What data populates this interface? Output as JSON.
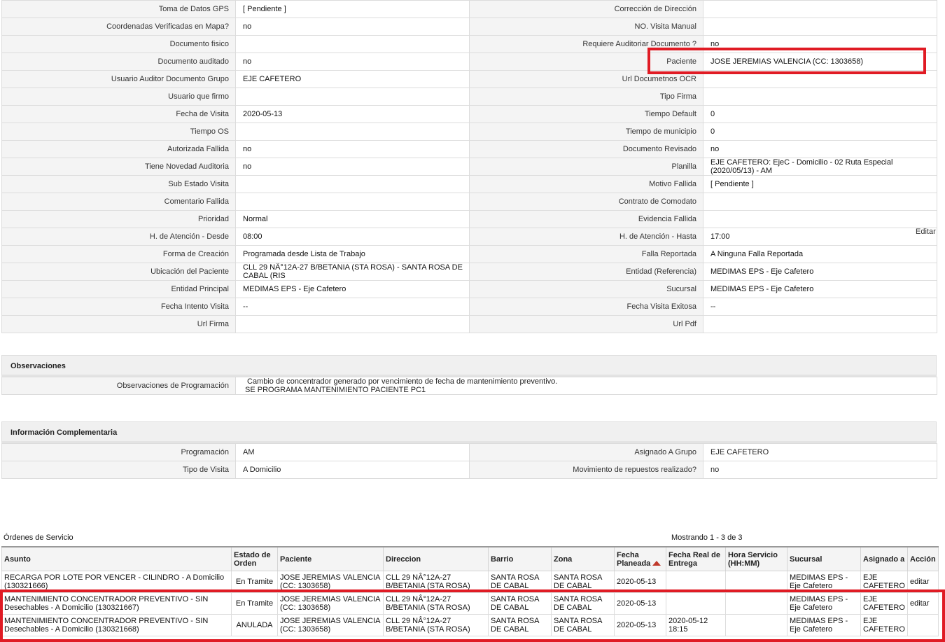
{
  "details": [
    [
      "Toma de Datos GPS",
      "[ Pendiente ]",
      "Corrección de Dirección",
      ""
    ],
    [
      "Coordenadas Verificadas en Mapa?",
      "no",
      "NO. Visita Manual",
      ""
    ],
    [
      "Documento fisico",
      "",
      "Requiere Auditoriar Documento ?",
      "no"
    ],
    [
      "Documento auditado",
      "no",
      "Paciente",
      "JOSE JEREMIAS VALENCIA (CC: 1303658)"
    ],
    [
      "Usuario Auditor Documento Grupo",
      "EJE CAFETERO",
      "Url Documetnos OCR",
      ""
    ],
    [
      "Usuario que firmo",
      "",
      "Tipo Firma",
      ""
    ],
    [
      "Fecha de Visita",
      "2020-05-13",
      "Tiempo Default",
      "0"
    ],
    [
      "Tiempo OS",
      "",
      "Tiempo de municipio",
      "0"
    ],
    [
      "Autorizada Fallida",
      "no",
      "Documento Revisado",
      "no"
    ],
    [
      "Tiene Novedad Auditoria",
      "no",
      "Planilla",
      "EJE CAFETERO: EjeC - Domicilio - 02 Ruta Especial (2020/05/13) - AM"
    ],
    [
      "Sub Estado Visita",
      "",
      "Motivo Fallida",
      "[ Pendiente ]"
    ],
    [
      "Comentario Fallida",
      "",
      "Contrato de Comodato",
      ""
    ],
    [
      "Prioridad",
      "Normal",
      "Evidencia Fallida",
      ""
    ],
    [
      "H. de Atención - Desde",
      "08:00",
      "H. de Atención - Hasta",
      "17:00"
    ],
    [
      "Forma de Creación",
      "Programada desde Lista de Trabajo",
      "Falla Reportada",
      "A Ninguna Falla Reportada"
    ],
    [
      "Ubicación del Paciente",
      "CLL 29 NÂ°12A-27 B/BETANIA (STA ROSA) - SANTA ROSA DE CABAL (RIS",
      "Entidad (Referencia)",
      "MEDIMAS EPS - Eje Cafetero"
    ],
    [
      "Entidad Principal",
      "MEDIMAS EPS - Eje Cafetero",
      "Sucursal",
      "MEDIMAS EPS - Eje Cafetero"
    ],
    [
      "Fecha Intento Visita",
      "--",
      "Fecha Visita Exitosa",
      "--"
    ],
    [
      "Url Firma",
      "",
      "Url Pdf",
      ""
    ]
  ],
  "editar_label": "Editar",
  "observaciones": {
    "title": "Observaciones",
    "label": "Observaciones de Programación",
    "line1": "Cambio de concentrador generado por vencimiento de fecha de mantenimiento preventivo.",
    "line2": "SE PROGRAMA MANTENIMIENTO PACIENTE PC1"
  },
  "complementaria": {
    "title": "Información Complementaria",
    "rows": [
      [
        "Programación",
        "AM",
        "Asignado A Grupo",
        "EJE CAFETERO"
      ],
      [
        "Tipo de Visita",
        "A Domicilio",
        "Movimiento de repuestos realizado?",
        "no"
      ]
    ]
  },
  "orders": {
    "title": "Órdenes de Servicio",
    "showing": "Mostrando 1 - 3 de 3",
    "headers": [
      "Asunto",
      "Estado de Orden",
      "Paciente",
      "Direccion",
      "Barrio",
      "Zona",
      "Fecha Planeada",
      "Fecha Real de Entrega",
      "Hora Servicio (HH:MM)",
      "Sucursal",
      "Asignado a",
      "Acción"
    ],
    "rows": [
      [
        "RECARGA POR LOTE POR VENCER - CILINDRO - A Domicilio (130321666)",
        "En Tramite",
        "JOSE JEREMIAS VALENCIA (CC: 1303658)",
        "CLL 29 NÂ°12A-27 B/BETANIA (STA ROSA)",
        "SANTA ROSA DE CABAL",
        "SANTA ROSA DE CABAL",
        "2020-05-13",
        "",
        "",
        "MEDIMAS EPS - Eje Cafetero",
        "EJE CAFETERO",
        "editar"
      ],
      [
        "MANTENIMIENTO CONCENTRADOR PREVENTIVO - SIN Desechables - A Domicilio (130321667)",
        "En Tramite",
        "JOSE JEREMIAS VALENCIA (CC: 1303658)",
        "CLL 29 NÂ°12A-27 B/BETANIA (STA ROSA)",
        "SANTA ROSA DE CABAL",
        "SANTA ROSA DE CABAL",
        "2020-05-13",
        "",
        "",
        "MEDIMAS EPS - Eje Cafetero",
        "EJE CAFETERO",
        "editar"
      ],
      [
        "MANTENIMIENTO CONCENTRADOR PREVENTIVO - SIN Desechables - A Domicilio (130321668)",
        "ANULADA",
        "JOSE JEREMIAS VALENCIA (CC: 1303658)",
        "CLL 29 NÂ°12A-27 B/BETANIA (STA ROSA)",
        "SANTA ROSA DE CABAL",
        "SANTA ROSA DE CABAL",
        "2020-05-13",
        "2020-05-12 18:15",
        "",
        "MEDIMAS EPS - Eje Cafetero",
        "EJE CAFETERO",
        ""
      ]
    ]
  },
  "highlight_color": "#e01b24"
}
